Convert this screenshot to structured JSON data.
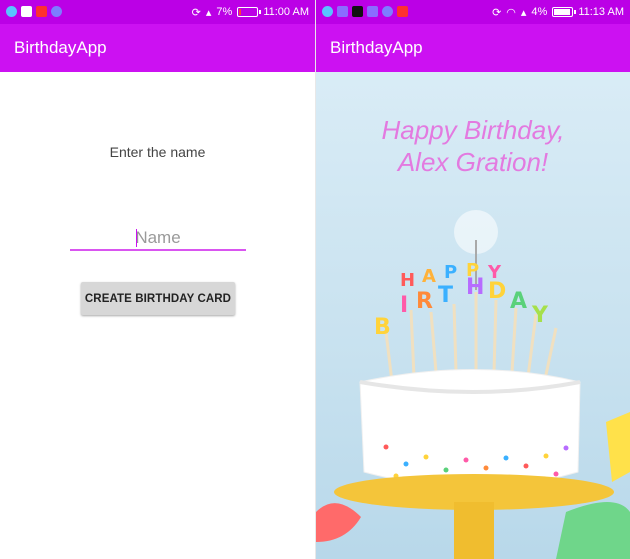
{
  "left_screen": {
    "status": {
      "battery": "7%",
      "time": "11:00 AM"
    },
    "appbar": {
      "title": "BirthdayApp"
    },
    "instruction": "Enter the name",
    "name_field": {
      "placeholder": "Name",
      "value": ""
    },
    "create_button": "CREATE BIRTHDAY CARD",
    "battery_level": 0.07
  },
  "right_screen": {
    "status": {
      "battery": "4%",
      "time": "11:13 AM"
    },
    "appbar": {
      "title": "BirthdayApp"
    },
    "greeting_line1": "Happy Birthday,",
    "greeting_line2": "Alex Gration!",
    "cake_topper": "HAPPY BIRTHDAY",
    "battery_level": 0.04
  },
  "colors": {
    "status_bar": "#bb00e6",
    "app_bar": "#cc11f2",
    "greeting": "#e37ae0",
    "input_underline": "#d955f0"
  }
}
